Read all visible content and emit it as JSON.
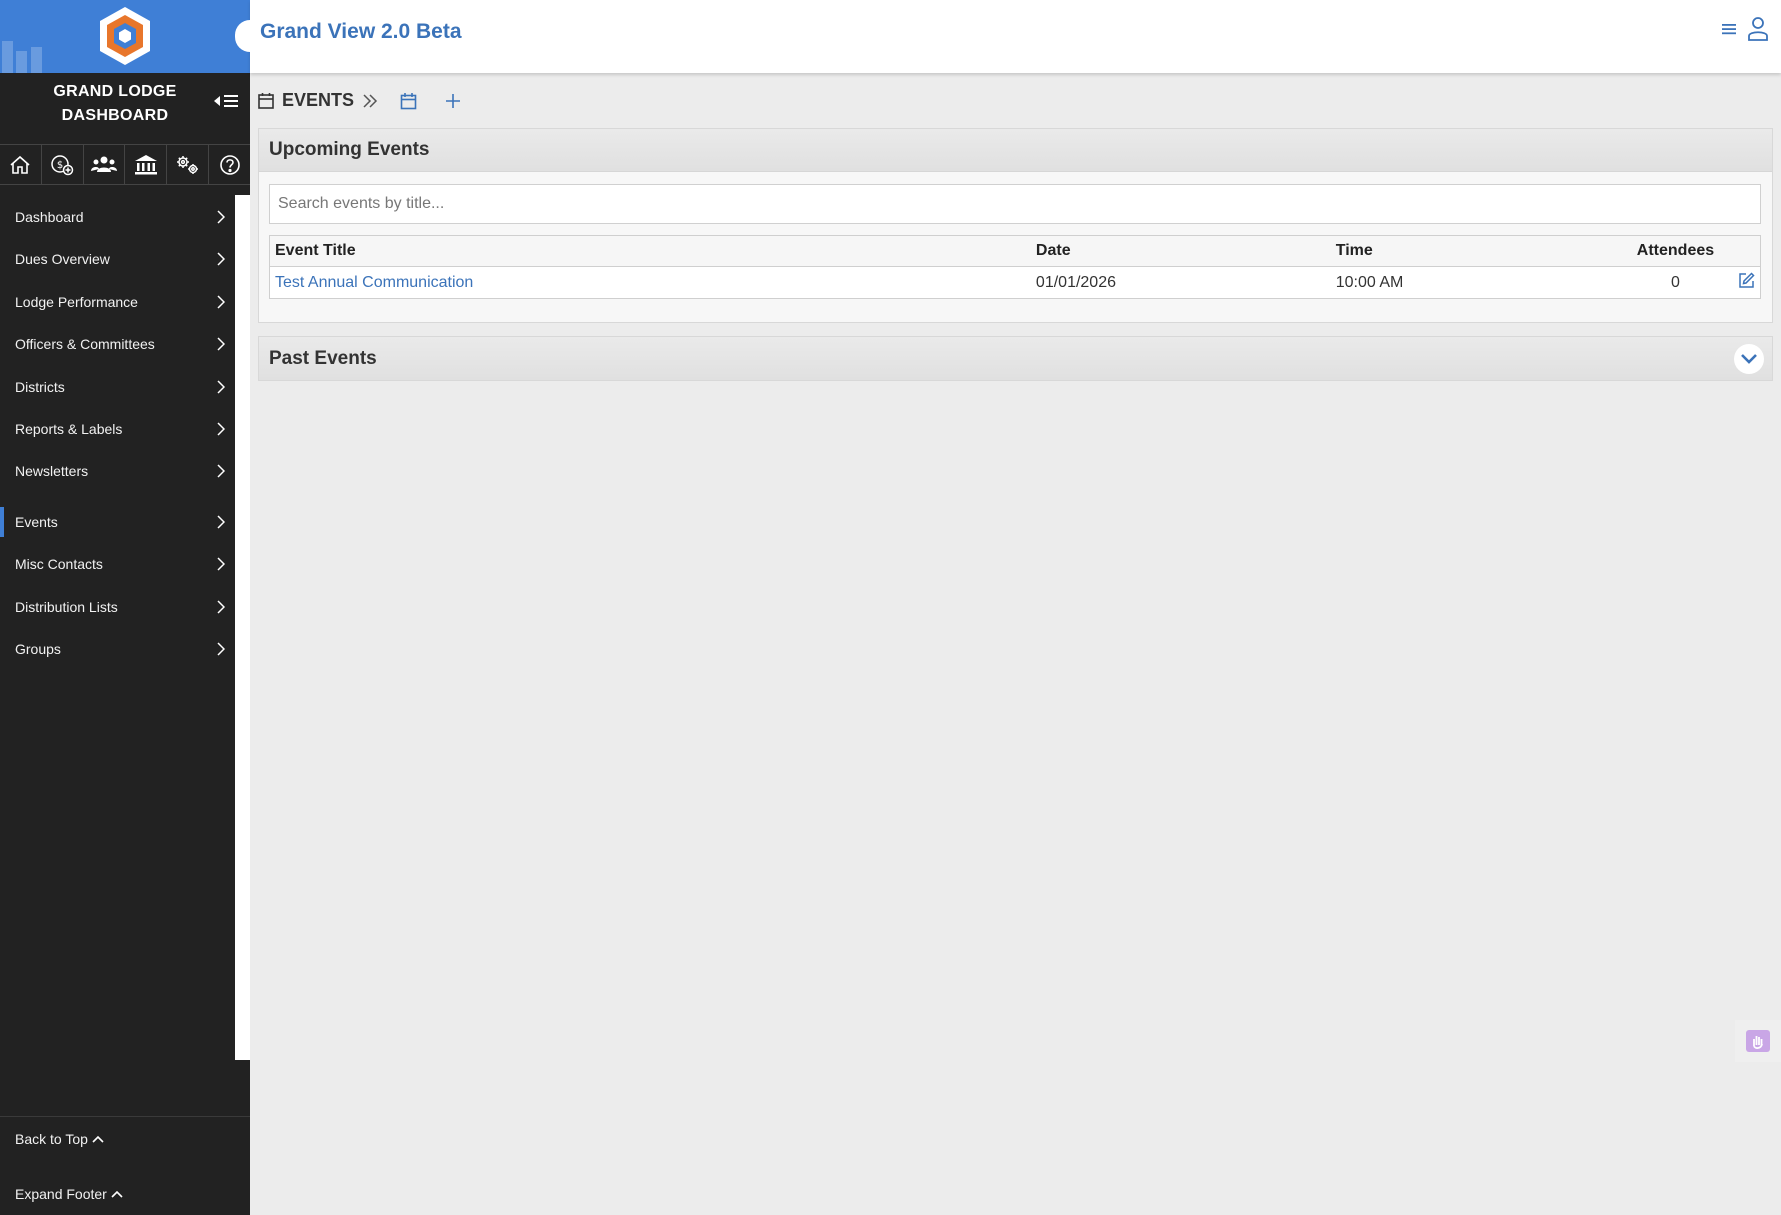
{
  "app": {
    "title": "Grand View 2.0 Beta"
  },
  "sidebar": {
    "title_line1": "GRAND LODGE",
    "title_line2": "DASHBOARD",
    "icons": [
      "home-icon",
      "dues-money-icon",
      "members-icon",
      "lodge-building-icon",
      "settings-gears-icon",
      "help-icon"
    ],
    "items": [
      {
        "label": "Dashboard"
      },
      {
        "label": "Dues Overview"
      },
      {
        "label": "Lodge Performance"
      },
      {
        "label": "Officers & Committees"
      },
      {
        "label": "Districts"
      },
      {
        "label": "Reports & Labels"
      },
      {
        "label": "Newsletters"
      },
      {
        "label": "Events",
        "active": true
      },
      {
        "label": "Misc Contacts"
      },
      {
        "label": "Distribution Lists"
      },
      {
        "label": "Groups"
      }
    ],
    "back_to_top": "Back to Top",
    "expand_footer": "Expand Footer"
  },
  "breadcrumb": {
    "label": "EVENTS"
  },
  "upcoming": {
    "title": "Upcoming Events",
    "search_placeholder": "Search events by title...",
    "columns": [
      "Event Title",
      "Date",
      "Time",
      "Attendees"
    ],
    "rows": [
      {
        "title": "Test Annual Communication",
        "date": "01/01/2026",
        "time": "10:00 AM",
        "attendees": "0"
      }
    ]
  },
  "past": {
    "title": "Past Events"
  },
  "colors": {
    "accent": "#3f7fd6",
    "link": "#3b73b9",
    "sidebar_bg": "#222222",
    "logo_orange": "#e8762b"
  }
}
